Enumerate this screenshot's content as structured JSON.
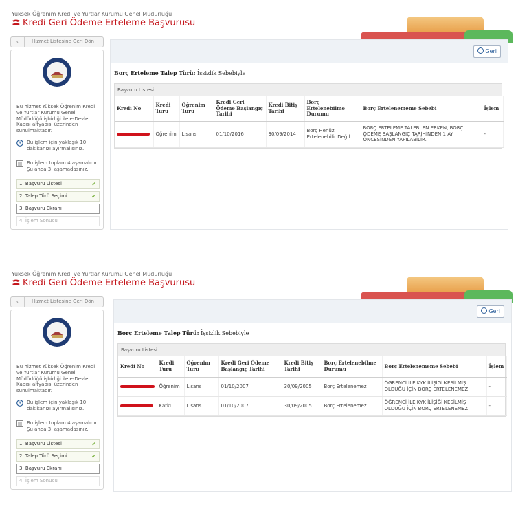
{
  "header": {
    "agency": "Yüksek Öğrenim Kredi ve Yurtlar Kurumu Genel Müdürlüğü",
    "title": "Kredi Geri Ödeme Erteleme Başvurusu"
  },
  "sidebar": {
    "back_label": "Hizmet Listesine Geri Dön",
    "description": "Bu hizmet Yüksek Öğrenim Kredi ve Yurtlar Kurumu Genel Müdürlüğü işbirliği ile e-Devlet Kapısı altyapısı üzerinden sunulmaktadır.",
    "time_info": "Bu işlem için yaklaşık 10 dakikanızı ayırmalısınız.",
    "steps_info": "Bu işlem toplam 4 aşamalıdır. Şu anda 3. aşamadasınız.",
    "steps": [
      {
        "label": "1. Başvuru Listesi"
      },
      {
        "label": "2. Talep Türü Seçimi"
      },
      {
        "label": "3. Başvuru Ekranı"
      },
      {
        "label": "4. İşlem Sonucu"
      }
    ]
  },
  "main": {
    "geri_label": "Geri",
    "request_type_label": "Borç Erteleme Talep Türü:",
    "request_type_value": "İşsizlik Sebebiyle",
    "panel_title": "Başvuru Listesi"
  },
  "table1": {
    "headers": [
      "Kredi No",
      "Kredi Türü",
      "Öğrenim Türü",
      "Kredi Geri Ödeme Başlangıç Tarihi",
      "Kredi Bitiş Tarihi",
      "Borç Ertelenebilme Durumu",
      "Borç Ertelenememe Sebebi",
      "İşlem"
    ],
    "rows": [
      {
        "kredi_turu": "Öğrenim",
        "ogrenim_turu": "Lisans",
        "baslangic": "01/10/2016",
        "bitis": "30/09/2014",
        "durum": "Borç Henüz Ertelenebilir Değil",
        "sebep": "BORÇ ERTELEME TALEBİ EN ERKEN, BORÇ ÖDEME BAŞLANGIÇ TARİHİNDEN 1 AY ÖNCESİNDEN YAPILABİLİR.",
        "islem": "-"
      }
    ]
  },
  "table2": {
    "headers": [
      "Kredi No",
      "Kredi Türü",
      "Öğrenim Türü",
      "Kredi Geri Ödeme Başlangıç Tarihi",
      "Kredi Bitiş Tarihi",
      "Borç Ertelenebilme Durumu",
      "Borç Ertelenememe Sebebi",
      "İşlem"
    ],
    "rows": [
      {
        "kredi_turu": "Öğrenim",
        "ogrenim_turu": "Lisans",
        "baslangic": "01/10/2007",
        "bitis": "30/09/2005",
        "durum": "Borç Ertelenemez",
        "sebep": "ÖĞRENCİ İLE KYK İLİŞİĞİ KESİLMİŞ OLDUĞU İÇİN BORÇ ERTELENEMEZ",
        "islem": "-"
      },
      {
        "kredi_turu": "Katkı",
        "ogrenim_turu": "Lisans",
        "baslangic": "01/10/2007",
        "bitis": "30/09/2005",
        "durum": "Borç Ertelenemez",
        "sebep": "ÖĞRENCİ İLE KYK İLİŞİĞİ KESİLMİŞ OLDUĞU İÇİN BORÇ ERTELENEMEZ",
        "islem": "-"
      }
    ]
  },
  "colors": {
    "brand_red": "#c4161c",
    "redaction": "#d0121b",
    "check_green": "#7cb342",
    "link_blue": "#2a5e9a"
  },
  "icons": [
    "logo-icon",
    "back-arrow-icon",
    "seal-icon",
    "clock-icon",
    "list-icon",
    "check-icon",
    "back-icon"
  ]
}
